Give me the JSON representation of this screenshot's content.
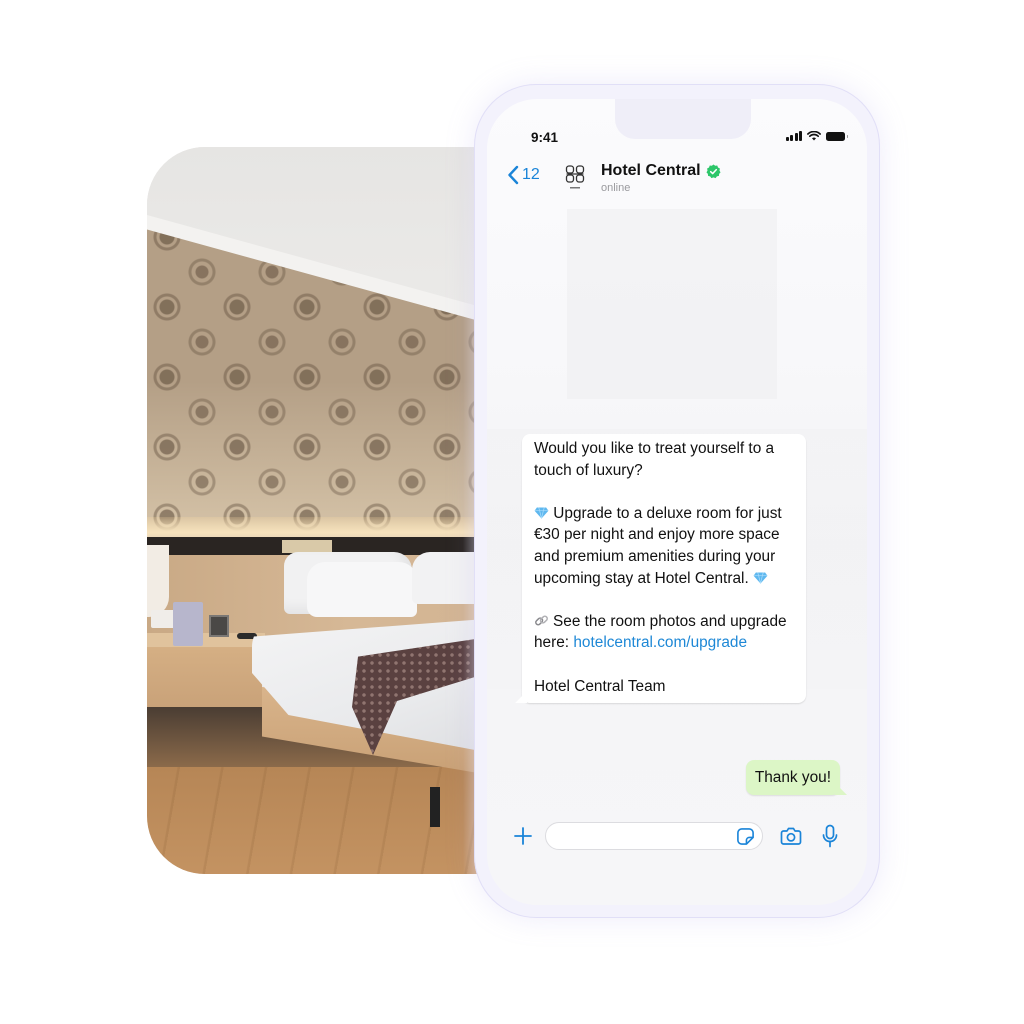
{
  "colors": {
    "accent_blue": "#1a84d8",
    "link_blue": "#1e88d6",
    "verified_green": "#2dc66a",
    "outgoing_bubble": "#dcf6c6",
    "incoming_bubble": "#ffffff",
    "phone_frame": "#f3f2fc"
  },
  "photo": {
    "subject": "hotel-room-bed",
    "icon": "hotel-room-photo"
  },
  "status_bar": {
    "time": "9:41",
    "icons": [
      "signal-icon",
      "wifi-icon",
      "battery-icon"
    ]
  },
  "chat_header": {
    "back_count": "12",
    "back_icon": "chevron-left-icon",
    "logo_icon": "hotel-logo-icon",
    "logo_caption": "HOTEL",
    "contact_name": "Hotel Central",
    "verified_icon": "verified-badge-icon",
    "contact_status": "online"
  },
  "messages": [
    {
      "direction": "incoming",
      "paragraphs": {
        "p1": "Would you like to treat yourself to a touch of luxury?",
        "p2_emoji": "gem-icon",
        "p2": "Upgrade to a deluxe room for just €30 per night and enjoy more space and premium amenities during your upcoming stay at Hotel Central.",
        "p3_emoji": "link-icon",
        "p3": "See the room photos and upgrade here: ",
        "p3_link": "hotelcentral.com/upgrade",
        "p3_link_display_1": "hotelcentral.com/",
        "p3_link_display_2": "upgrade",
        "p4": "Hotel Central Team"
      }
    },
    {
      "direction": "outgoing",
      "text": "Thank you!"
    }
  ],
  "input_bar": {
    "plus_icon": "plus-icon",
    "placeholder": "",
    "value": "",
    "sticker_icon": "sticker-icon",
    "camera_icon": "camera-icon",
    "mic_icon": "microphone-icon"
  }
}
